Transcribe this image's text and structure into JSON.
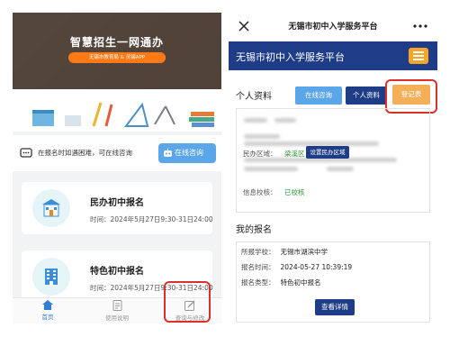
{
  "left": {
    "banner": {
      "title": "智慧招生一网通办",
      "subtitle": "无锡市教育局 & 灵锡APP"
    },
    "tip": {
      "text": "在报名时如遇困难，可在线咨询",
      "button_label": "在线咨询"
    },
    "cards": [
      {
        "title": "民办初中报名",
        "time": "时间：2024年5月27日9:30-31日24:00"
      },
      {
        "title": "特色初中报名",
        "time": "时间：2024年5月27日9:30-31日24:00"
      }
    ],
    "tabbar": [
      {
        "label": "首页",
        "icon": "home-icon"
      },
      {
        "label": "使用说明",
        "icon": "document-icon"
      },
      {
        "label": "查询与修改",
        "icon": "edit-icon"
      }
    ],
    "colors": {
      "accent": "#2f7fd8",
      "highlight": "#d9312b"
    }
  },
  "right": {
    "topbar_title": "无锡市初中入学服务平台",
    "header_title": "无锡市初中入学服务平台",
    "profile": {
      "section_title": "个人资料",
      "btn_consult": "在线咨询",
      "btn_profile": "个人资料",
      "btn_register": "登记表",
      "district_label": "民办区域：",
      "district_value": "梁溪区",
      "district_button": "设置民办区域",
      "school_label": "信息校核：",
      "school_value": "已校核"
    },
    "registration": {
      "section_title": "我的报名",
      "rows": [
        {
          "label": "所报学校：",
          "value": "无锡市湖滨中学"
        },
        {
          "label": "报名时间：",
          "value": "2024-05-27 10:39:19"
        },
        {
          "label": "报名类型：",
          "value": "特色初中报名"
        }
      ],
      "detail_button": "查看详情"
    },
    "colors": {
      "header": "#1e3d86",
      "menu": "#f4a62a",
      "register": "#f4b059",
      "green": "#2e9a3a"
    }
  }
}
